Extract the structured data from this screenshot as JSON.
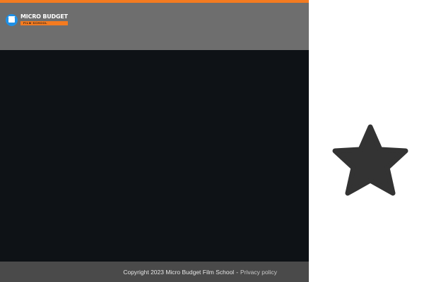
{
  "header": {
    "logo": {
      "title": "MICRO BUDGET",
      "subtitle": "FILM SCHOOL",
      "icon": "clapperboard-icon"
    }
  },
  "footer": {
    "copyright": "Copyright 2023 Micro Budget Film School",
    "separator": "-",
    "privacy_link": "Privacy policy"
  },
  "side_widget": {
    "icon": "star-icon"
  },
  "colors": {
    "accent": "#f47b20",
    "header_bg": "#6e6e6e",
    "main_bg": "#0e1216",
    "footer_bg": "#4a4a4a",
    "logo_blue": "#1e90e6",
    "star": "#333333"
  }
}
